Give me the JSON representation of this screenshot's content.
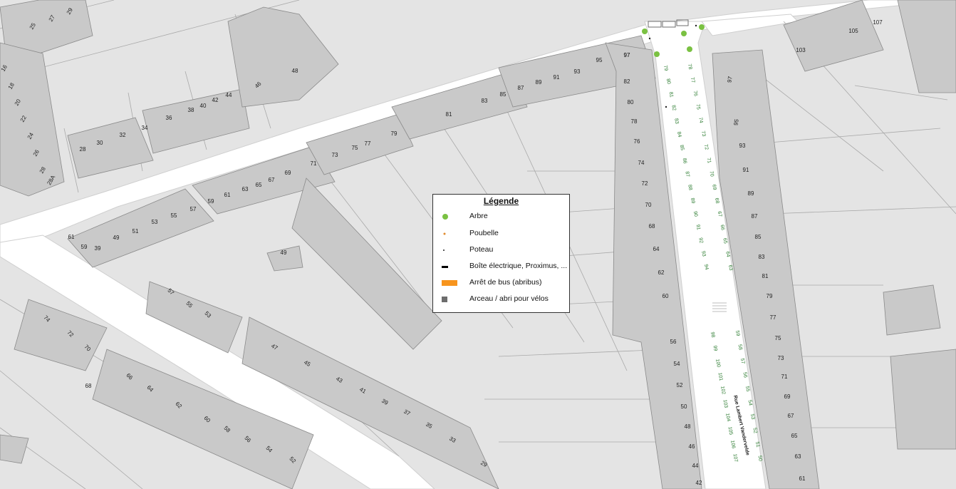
{
  "legend": {
    "title": "Légende",
    "items": [
      {
        "label": "Arbre",
        "icon": "tree-icon",
        "color": "#7ac142"
      },
      {
        "label": "Poubelle",
        "icon": "bin-icon",
        "color": "#e08a2c"
      },
      {
        "label": "Poteau",
        "icon": "pole-icon",
        "color": "#222222"
      },
      {
        "label": "Boîte électrique, Proximus, ...",
        "icon": "utility-box-icon",
        "color": "#000000"
      },
      {
        "label": "Arrêt de bus (abribus)",
        "icon": "bus-stop-icon",
        "color": "#f7941d"
      },
      {
        "label": "Arceau / abri pour vélos",
        "icon": "bike-rack-icon",
        "color": "#6d6d6d"
      }
    ]
  },
  "street_name": "Rue Lambert Vandervelde",
  "house_numbers": [
    "25",
    "27",
    "29",
    "16",
    "18",
    "20",
    "22",
    "24",
    "26",
    "28",
    "28A",
    "46",
    "48",
    "28",
    "30",
    "32",
    "34",
    "36",
    "38",
    "40",
    "42",
    "44",
    "79",
    "81",
    "83",
    "85",
    "87",
    "89",
    "91",
    "93",
    "95",
    "97",
    "61",
    "59",
    "39",
    "49",
    "51",
    "53",
    "55",
    "57",
    "59",
    "61",
    "63",
    "65",
    "67",
    "69",
    "71",
    "73",
    "75",
    "77",
    "49",
    "57",
    "55",
    "53",
    "74",
    "72",
    "70",
    "68",
    "66",
    "64",
    "62",
    "60",
    "58",
    "56",
    "54",
    "52",
    "47",
    "45",
    "43",
    "41",
    "39",
    "37",
    "35",
    "33",
    "29",
    "97",
    "82",
    "80",
    "78",
    "76",
    "74",
    "72",
    "70",
    "68",
    "64",
    "62",
    "60",
    "56",
    "54",
    "52",
    "50",
    "48",
    "46",
    "44",
    "42",
    "103",
    "105",
    "107",
    "97",
    "95",
    "93",
    "91",
    "89",
    "87",
    "85",
    "83",
    "81",
    "79",
    "77",
    "75",
    "73",
    "71",
    "69",
    "67",
    "65",
    "63",
    "61"
  ],
  "parking_numbers": [
    "79",
    "80",
    "81",
    "82",
    "83",
    "84",
    "85",
    "86",
    "87",
    "88",
    "89",
    "90",
    "91",
    "92",
    "93",
    "94",
    "78",
    "77",
    "76",
    "75",
    "74",
    "73",
    "72",
    "71",
    "70",
    "69",
    "68",
    "67",
    "66",
    "65",
    "64",
    "63",
    "98",
    "99",
    "100",
    "101",
    "102",
    "103",
    "104",
    "105",
    "106",
    "107",
    "59",
    "58",
    "57",
    "56",
    "55",
    "54",
    "53",
    "52",
    "51",
    "50"
  ],
  "colors": {
    "background": "#e4e4e4",
    "street": "#ffffff",
    "building": "#c9c9c9",
    "building_outline": "#8a8a8a",
    "parcel_line": "#a8a8a8",
    "tree": "#7ac142",
    "parking_number": "#2e7d32"
  }
}
